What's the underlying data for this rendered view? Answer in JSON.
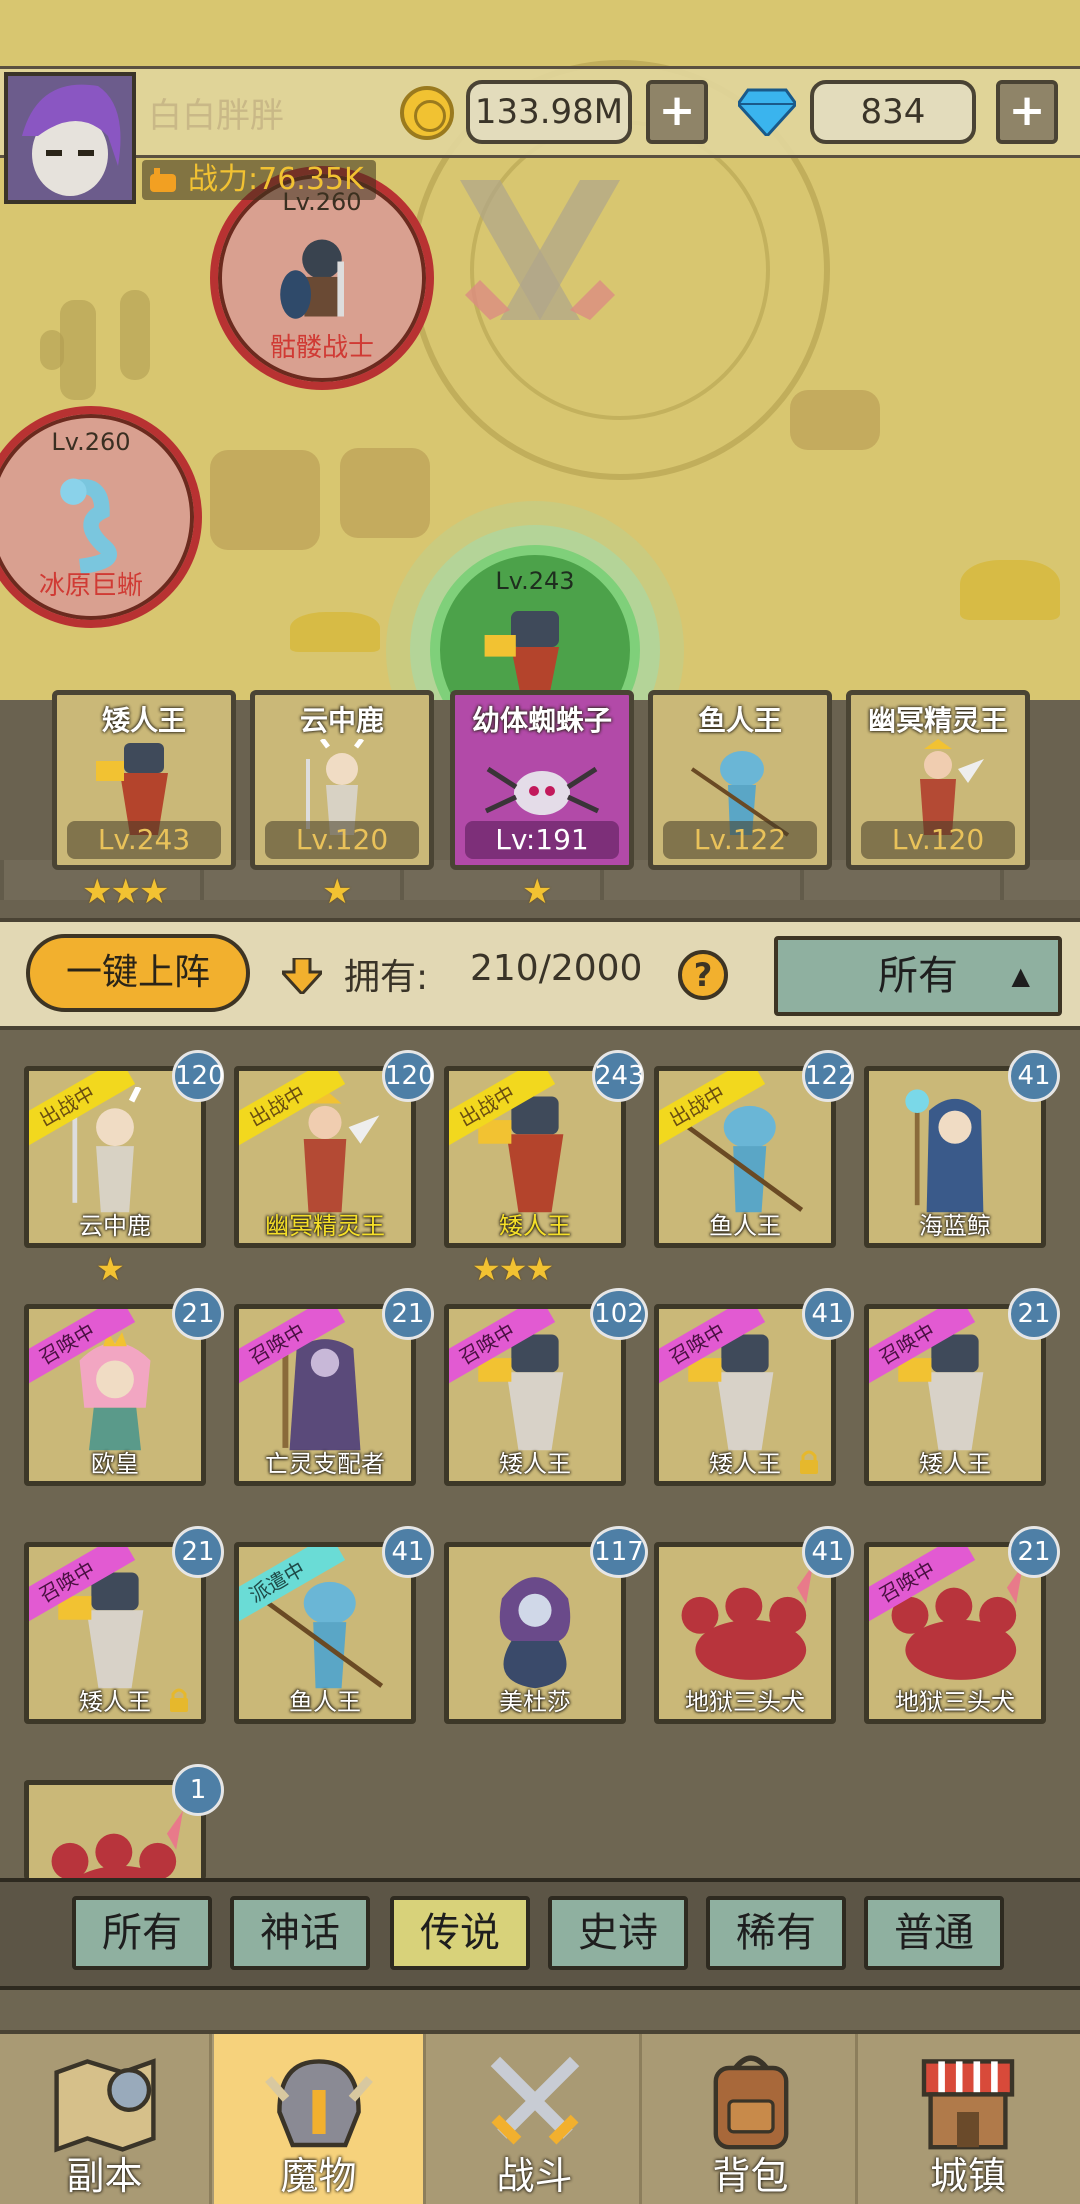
{
  "player": {
    "name": "白白胖胖",
    "power": "战力:76.35K"
  },
  "resources": {
    "gold": "133.98M",
    "gems": "834",
    "plus": "+"
  },
  "map_nodes": [
    {
      "level": "Lv.260",
      "name": "骷髅战士"
    },
    {
      "level": "Lv.260",
      "name": "冰原巨蜥"
    },
    {
      "level": "Lv.243"
    }
  ],
  "lineup": [
    {
      "name": "矮人王",
      "level": "Lv.243",
      "stars": "★★★",
      "color": "#cab878"
    },
    {
      "name": "云中鹿",
      "level": "Lv.120",
      "stars": "★",
      "color": "#cab878"
    },
    {
      "name": "幼体蜘蛛子",
      "level": "Lv:191",
      "stars": "★",
      "color": "#b24aa8"
    },
    {
      "name": "鱼人王",
      "level": "Lv.122",
      "stars": "",
      "color": "#cab878"
    },
    {
      "name": "幽冥精灵王",
      "level": "Lv.120",
      "stars": "",
      "color": "#cab878"
    }
  ],
  "filter": {
    "auto_button": "一键上阵",
    "owned_label": "拥有:",
    "owned_value": "210/2000",
    "help": "?",
    "sort": "所有",
    "sort_chevron": "▲"
  },
  "monsters": [
    {
      "name": "云中鹿",
      "level": "120",
      "tag": "出战中",
      "stars": "★",
      "name_color": "white"
    },
    {
      "name": "幽冥精灵王",
      "level": "120",
      "tag": "出战中",
      "stars": "",
      "name_color": "yellow"
    },
    {
      "name": "矮人王",
      "level": "243",
      "tag": "出战中",
      "stars": "★★★",
      "name_color": "yellow"
    },
    {
      "name": "鱼人王",
      "level": "122",
      "tag": "出战中",
      "stars": "",
      "name_color": "white"
    },
    {
      "name": "海蓝鲸",
      "level": "41",
      "tag": "",
      "stars": "",
      "name_color": "white"
    },
    {
      "name": "欧皇",
      "level": "21",
      "tag": "召唤中",
      "stars": "",
      "name_color": "white"
    },
    {
      "name": "亡灵支配者",
      "level": "21",
      "tag": "召唤中",
      "stars": "",
      "name_color": "white"
    },
    {
      "name": "矮人王",
      "level": "102",
      "tag": "召唤中",
      "stars": "",
      "name_color": "white"
    },
    {
      "name": "矮人王",
      "level": "41",
      "tag": "召唤中",
      "stars": "",
      "name_color": "white",
      "locked": true
    },
    {
      "name": "矮人王",
      "level": "21",
      "tag": "召唤中",
      "stars": "",
      "name_color": "white"
    },
    {
      "name": "矮人王",
      "level": "21",
      "tag": "召唤中",
      "stars": "",
      "name_color": "white",
      "locked": true
    },
    {
      "name": "鱼人王",
      "level": "41",
      "tag": "派遣中",
      "stars": "",
      "name_color": "white"
    },
    {
      "name": "美杜莎",
      "level": "117",
      "tag": "",
      "stars": "",
      "name_color": "white"
    },
    {
      "name": "地狱三头犬",
      "level": "41",
      "tag": "",
      "stars": "",
      "name_color": "white"
    },
    {
      "name": "地狱三头犬",
      "level": "21",
      "tag": "召唤中",
      "stars": "",
      "name_color": "white"
    },
    {
      "name": "",
      "level": "1",
      "tag": "",
      "stars": "",
      "name_color": "white"
    }
  ],
  "rarity_tabs": [
    "所有",
    "神话",
    "传说",
    "史诗",
    "稀有",
    "普通"
  ],
  "rarity_active_index": 2,
  "bottom_nav": [
    {
      "label": "副本",
      "icon": "map-compass-icon"
    },
    {
      "label": "魔物",
      "icon": "monster-helmet-icon"
    },
    {
      "label": "战斗",
      "icon": "crossed-swords-icon"
    },
    {
      "label": "背包",
      "icon": "backpack-icon"
    },
    {
      "label": "城镇",
      "icon": "town-shop-icon"
    }
  ],
  "bottom_nav_active_index": 1,
  "colors": {
    "map_bg": "#d8c670",
    "enemy_ring": "#b83232",
    "player_node": "#4ca24a",
    "summon_tag": "#e25ad2",
    "battle_tag": "#f2d81e",
    "dispatch_tag": "#6adcd6"
  }
}
